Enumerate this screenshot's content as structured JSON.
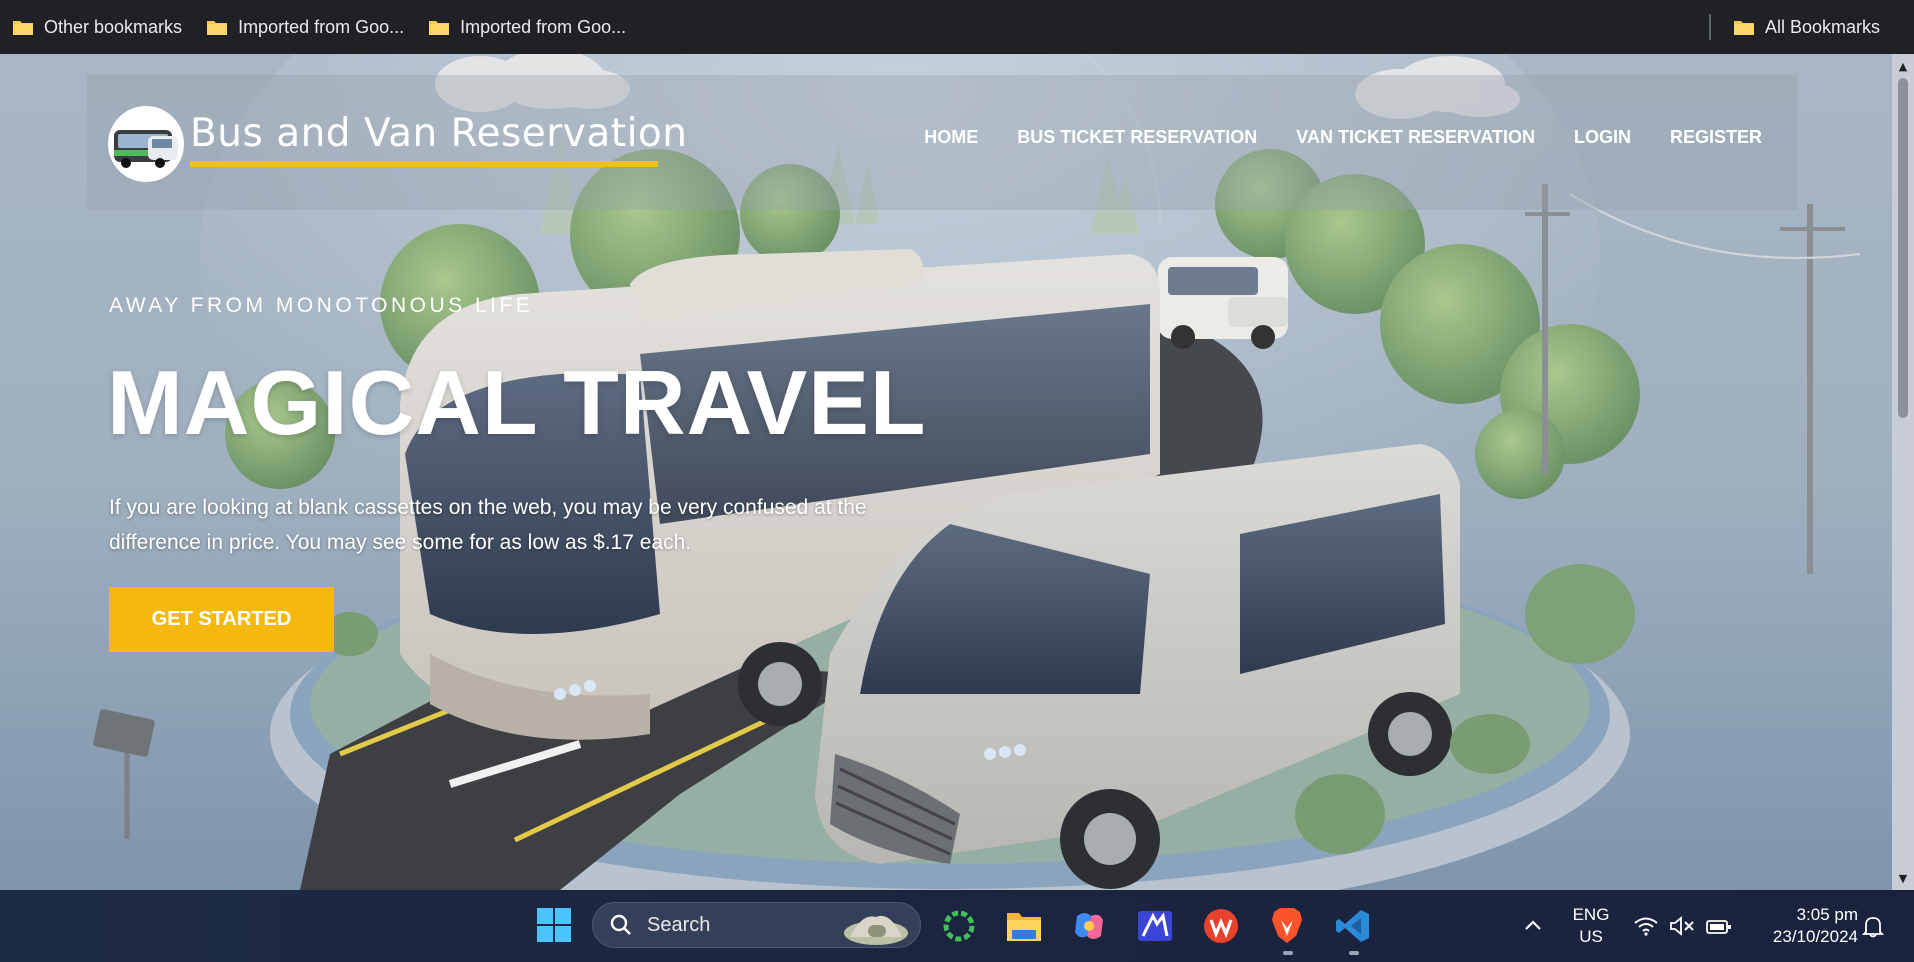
{
  "bookmarks_bar": {
    "items": [
      {
        "label": "Other bookmarks",
        "icon": "folder-icon"
      },
      {
        "label": "Imported from Goo...",
        "icon": "folder-icon"
      },
      {
        "label": "Imported from Goo...",
        "icon": "folder-icon"
      }
    ],
    "right": {
      "label": "All Bookmarks",
      "icon": "folder-icon"
    }
  },
  "site": {
    "brand": "Bus and Van Reservation",
    "nav": [
      "HOME",
      "BUS TICKET RESERVATION",
      "VAN TICKET RESERVATION",
      "LOGIN",
      "REGISTER"
    ],
    "hero": {
      "eyebrow": "AWAY FROM MONOTONOUS LIFE",
      "title": "MAGICAL TRAVEL",
      "description": "If you are looking at blank cassettes on the web, you may be very confused at the difference in price. You may see some for as low as $.17 each.",
      "cta": "GET STARTED"
    },
    "colors": {
      "accent": "#f5b90d",
      "underline": "#f2c01a"
    }
  },
  "taskbar": {
    "search_placeholder": "Search",
    "apps": [
      "windows-start",
      "search",
      "landscape-widget",
      "green-circle-app",
      "file-explorer",
      "copilot",
      "blue-app",
      "wps-office",
      "brave-browser",
      "vscode"
    ],
    "language": {
      "line1": "ENG",
      "line2": "US"
    },
    "time": "3:05 pm",
    "date": "23/10/2024"
  }
}
